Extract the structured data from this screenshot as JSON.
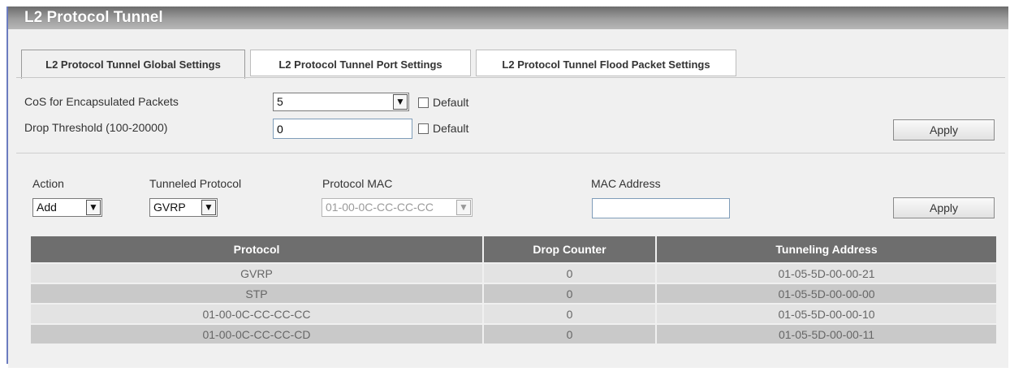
{
  "page": {
    "title": "L2 Protocol Tunnel"
  },
  "tabs": [
    {
      "label": "L2 Protocol Tunnel Global Settings"
    },
    {
      "label": "L2 Protocol Tunnel Port Settings"
    },
    {
      "label": "L2 Protocol Tunnel Flood Packet Settings"
    }
  ],
  "global": {
    "cos_label": "CoS for Encapsulated Packets",
    "cos_value": "5",
    "cos_default_label": "Default",
    "drop_label": "Drop Threshold (100-20000)",
    "drop_value": "0",
    "drop_default_label": "Default",
    "apply_label": "Apply"
  },
  "form": {
    "action_label": "Action",
    "action_value": "Add",
    "protocol_label": "Tunneled Protocol",
    "protocol_value": "GVRP",
    "mac_label": "Protocol MAC",
    "mac_value": "01-00-0C-CC-CC-CC",
    "mac_address_label": "MAC Address",
    "mac_address_value": "",
    "apply_label": "Apply"
  },
  "table": {
    "headers": [
      "Protocol",
      "Drop Counter",
      "Tunneling Address"
    ],
    "rows": [
      [
        "GVRP",
        "0",
        "01-05-5D-00-00-21"
      ],
      [
        "STP",
        "0",
        "01-05-5D-00-00-00"
      ],
      [
        "01-00-0C-CC-CC-CC",
        "0",
        "01-05-5D-00-00-10"
      ],
      [
        "01-00-0C-CC-CC-CD",
        "0",
        "01-05-5D-00-00-11"
      ]
    ]
  }
}
